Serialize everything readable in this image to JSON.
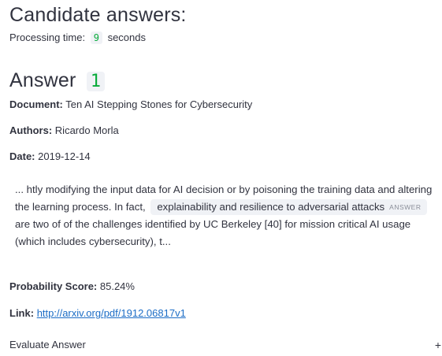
{
  "header": {
    "title": "Candidate answers:",
    "processing_label": "Processing time:",
    "processing_value": "9",
    "processing_unit": "seconds"
  },
  "answer": {
    "title": "Answer",
    "number": "1",
    "document_label": "Document:",
    "document_value": "Ten AI Stepping Stones for Cybersecurity",
    "authors_label": "Authors:",
    "authors_value": "Ricardo Morla",
    "date_label": "Date:",
    "date_value": "2019-12-14",
    "passage_before": "... htly modifying the input data for AI decision or by poisoning the training data and altering the learning process. In fact,",
    "passage_highlight": "explainability and resilience to adversarial attacks",
    "passage_tag": "ANSWER",
    "passage_after": "are two of of the challenges identified by UC Berkeley [40] for mission critical AI usage (which includes cybersecurity), t...",
    "probability_label": "Probability Score:",
    "probability_value": "85.24%",
    "link_label": "Link:",
    "link_value": "http://arxiv.org/pdf/1912.06817v1"
  },
  "expander": {
    "label": "Evaluate Answer",
    "icon": "plus-icon",
    "icon_glyph": "+"
  },
  "colors": {
    "text": "#31333f",
    "accent_green": "#09ab3b",
    "chip_bg": "#f0f2f6",
    "link": "#1c6dc6"
  }
}
